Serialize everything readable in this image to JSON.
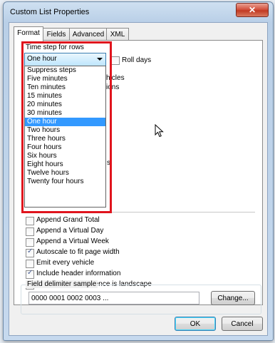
{
  "window": {
    "title": "Custom List Properties",
    "close_glyph": "✕"
  },
  "tabs": [
    {
      "label": "Format"
    },
    {
      "label": "Fields"
    },
    {
      "label": "Advanced"
    },
    {
      "label": "XML"
    }
  ],
  "format": {
    "time_step_label": "Time step for rows",
    "time_step_value": "One hour",
    "time_step_options": [
      "Suppress steps",
      "Five minutes",
      "Ten minutes",
      "15 minutes",
      "20 minutes",
      "30 minutes",
      "One hour",
      "Two hours",
      "Three hours",
      "Four hours",
      "Six hours",
      "Eight hours",
      "Twelve hours",
      "Twenty four hours"
    ],
    "roll_days_label": "Roll days",
    "partial_text_1": "hicles",
    "partial_text_2": "ions",
    "partial_text_3": "s",
    "options": [
      {
        "label": "Append Grand Total",
        "checked": false
      },
      {
        "label": "Append a Virtual Day",
        "checked": false
      },
      {
        "label": "Append a Virtual Week",
        "checked": false
      },
      {
        "label": "Autoscale to fit page width",
        "checked": true
      },
      {
        "label": "Emit every vehicle",
        "checked": false
      },
      {
        "label": "Include header information",
        "checked": true
      },
      {
        "label": "Page layout preference is landscape",
        "checked": false
      }
    ],
    "delimiter_group_label": "Field delimiter sample",
    "delimiter_sample": "0000 0001 0002 0003  ...",
    "change_button": "Change..."
  },
  "buttons": {
    "ok": "OK",
    "cancel": "Cancel"
  },
  "colors": {
    "highlight": "#e0141d",
    "selection": "#3399ff"
  }
}
